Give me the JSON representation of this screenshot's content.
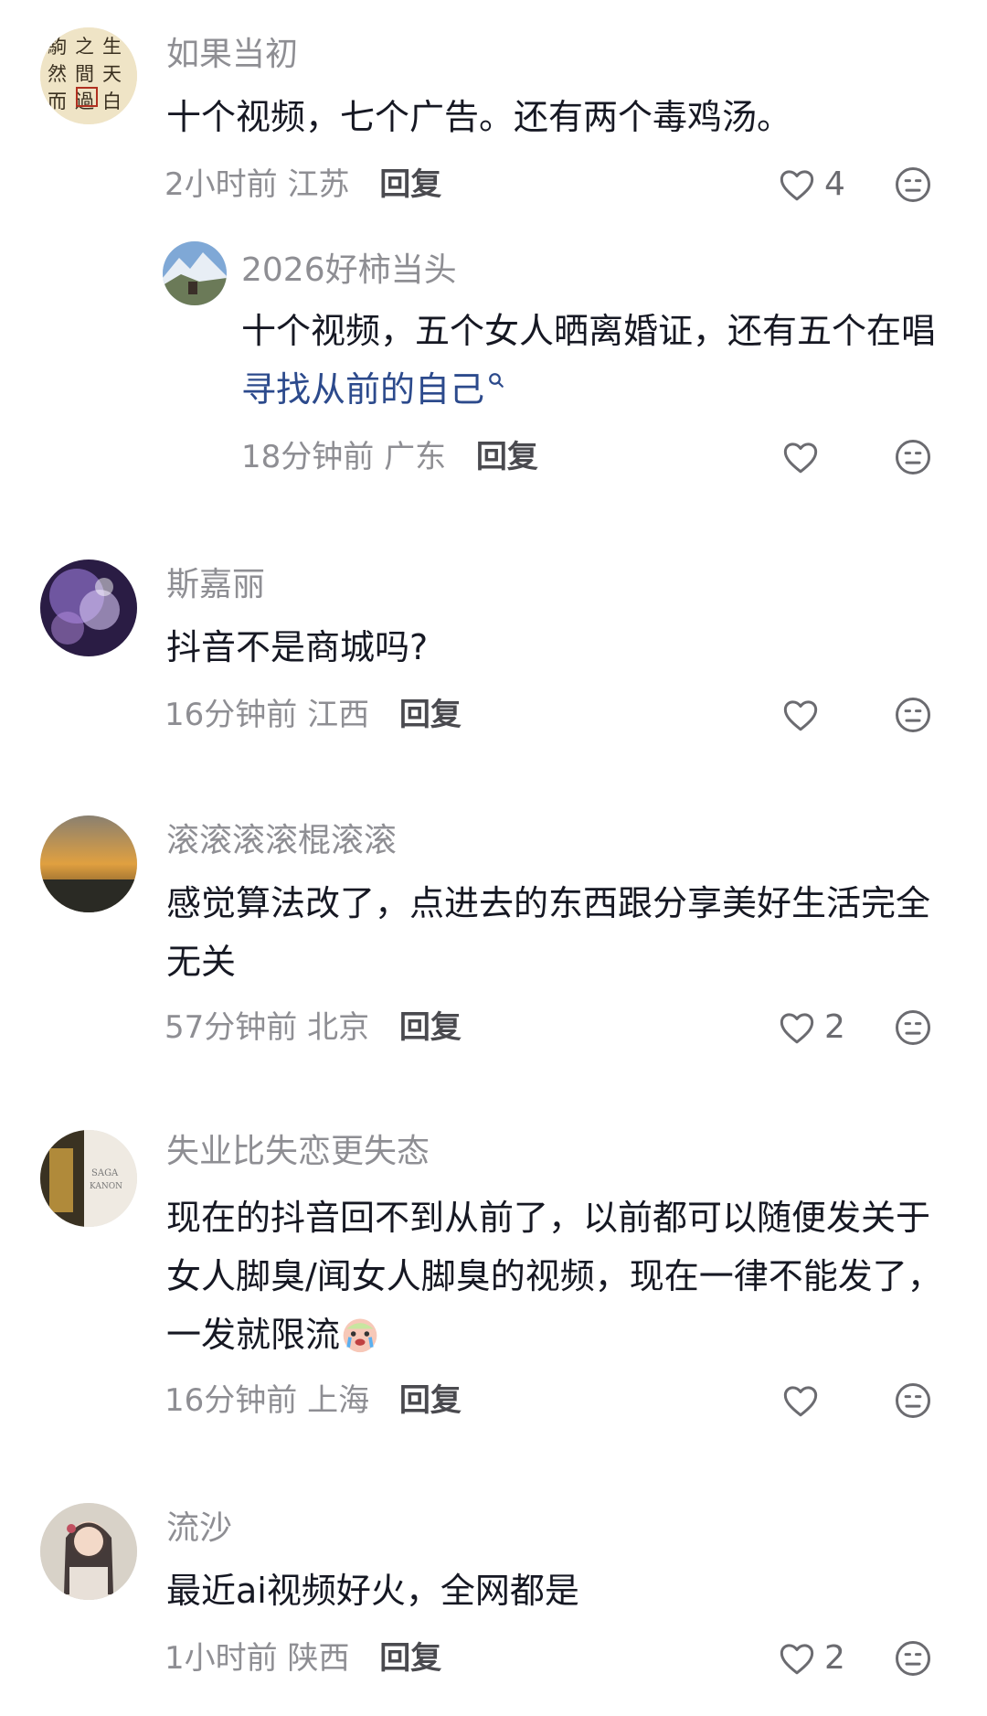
{
  "comments": [
    {
      "username": "如果当初",
      "text": "十个视频，七个广告。还有两个毒鸡汤。",
      "time": "2小时前",
      "location": "江苏",
      "reply_label": "回复",
      "likes": "4",
      "avatar_text": "駒之生然之間天過芸而隙白"
    },
    {
      "username": "2026好柿当头",
      "text_part1": "十个视频，五个女人晒离婚证，还有五个在唱",
      "link_text": "寻找从前的自己",
      "time": "18分钟前",
      "location": "广东",
      "reply_label": "回复",
      "likes": ""
    },
    {
      "username": "斯嘉丽",
      "text": "抖音不是商城吗?",
      "time": "16分钟前",
      "location": "江西",
      "reply_label": "回复",
      "likes": ""
    },
    {
      "username": "滚滚滚滚棍滚滚",
      "text": "感觉算法改了，点进去的东西跟分享美好生活完全无关",
      "time": "57分钟前",
      "location": "北京",
      "reply_label": "回复",
      "likes": "2"
    },
    {
      "username": "失业比失恋更失态",
      "text": "现在的抖音回不到从前了，以前都可以随便发关于女人脚臭/闻女人脚臭的视频，现在一律不能发了，一发就限流",
      "time": "16分钟前",
      "location": "上海",
      "reply_label": "回复",
      "likes": "",
      "avatar_text": "SAGA KANON"
    },
    {
      "username": "流沙",
      "text": "最近ai视频好火，全网都是",
      "time": "1小时前",
      "location": "陕西",
      "reply_label": "回复",
      "likes": "2"
    }
  ],
  "icons": {
    "like": "heart-outline-icon",
    "dislike": "neutral-face-icon",
    "search": "search-icon",
    "emoji": "crying-face-emoji"
  },
  "colors": {
    "username": "#8e8e93",
    "text": "#161823",
    "link": "#2c4a8c"
  }
}
